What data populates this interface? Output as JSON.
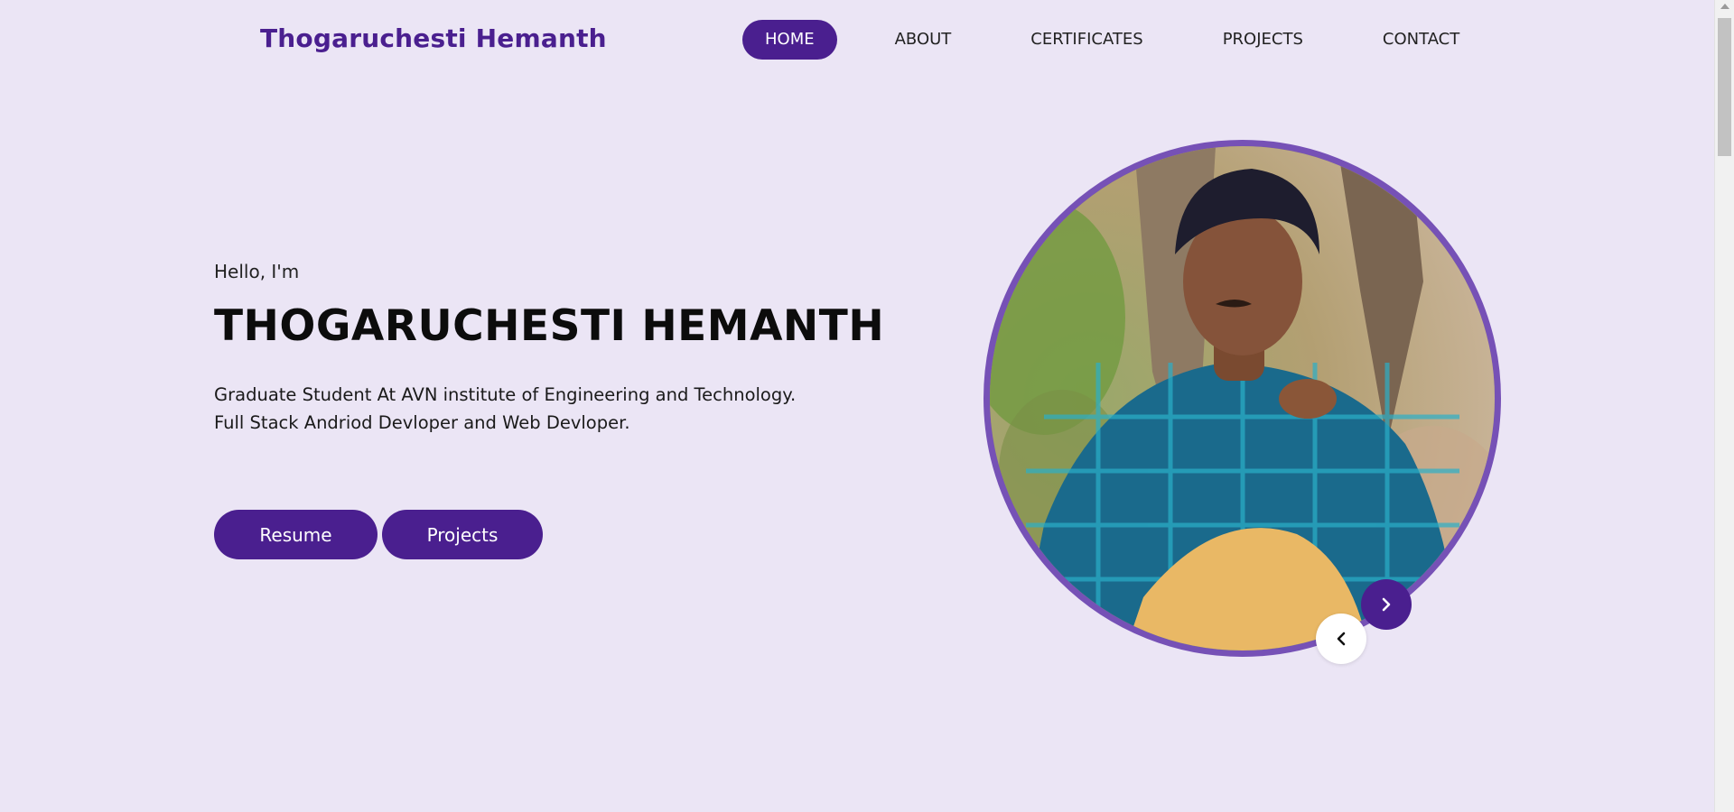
{
  "header": {
    "brand": "Thogaruchesti Hemanth",
    "nav": [
      {
        "label": "HOME",
        "active": true
      },
      {
        "label": "ABOUT",
        "active": false
      },
      {
        "label": "CERTIFICATES",
        "active": false
      },
      {
        "label": "PROJECTS",
        "active": false
      },
      {
        "label": "CONTACT",
        "active": false
      }
    ]
  },
  "hero": {
    "greeting": "Hello, I'm",
    "name": "THOGARUCHESTI HEMANTH",
    "description_line1": "Graduate Student At AVN institute of Engineering and Technology.",
    "description_line2": "Full Stack Andriod Devloper and Web Devloper.",
    "buttons": {
      "resume": "Resume",
      "projects": "Projects"
    }
  },
  "carousel": {
    "next_icon": "chevron-right-icon",
    "prev_icon": "chevron-left-icon"
  },
  "colors": {
    "background": "#ebe5f5",
    "accent": "#4a1f8f",
    "ring": "#7651b6"
  }
}
